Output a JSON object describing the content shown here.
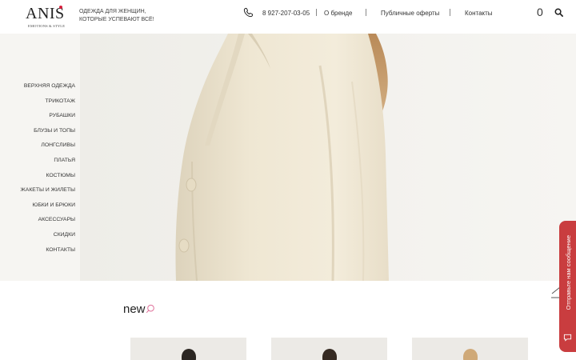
{
  "brand": {
    "logo_text": "ANIS",
    "tagline": "EMOTIONS & STYLE",
    "slogan_line1": "ОДЕЖДА ДЛЯ ЖЕНЩИН,",
    "slogan_line2": "КОТОРЫЕ УСПЕВАЮТ ВСЁ!",
    "accent_color": "#d81e3c"
  },
  "header": {
    "phone": "8 927-207-03-05",
    "nav": [
      "О бренде",
      "Публичные оферты",
      "Контакты"
    ],
    "cart_count": "0"
  },
  "sidebar": {
    "items": [
      "ВЕРХНЯЯ ОДЕЖДА",
      "ТРИКОТАЖ",
      "РУБАШКИ",
      "БЛУЗЫ И ТОПЫ",
      "ЛОНГСЛИВЫ",
      "ПЛАТЬЯ",
      "КОСТЮМЫ",
      "ЖАКЕТЫ И ЖИЛЕТЫ",
      "ЮБКИ И БРЮКИ",
      "АКСЕССУАРЫ",
      "СКИДКИ",
      "КОНТАКТЫ"
    ]
  },
  "new_section": {
    "title": "new"
  },
  "chat": {
    "label": "Отправьте нам сообщение",
    "color": "#c93d3f"
  },
  "icons": [
    "phone-icon",
    "search-icon",
    "heart-search-icon",
    "chevron-up-icon",
    "chat-icon"
  ]
}
